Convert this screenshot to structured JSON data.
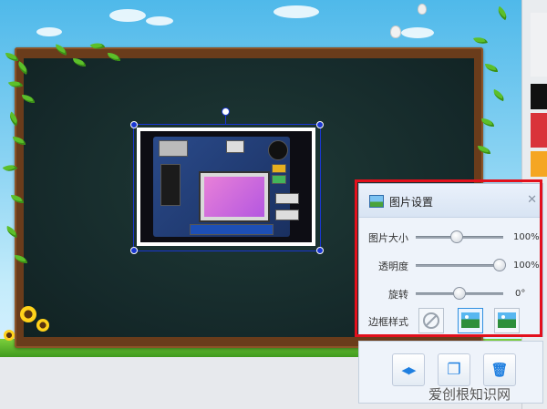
{
  "panel": {
    "title": "图片设置",
    "close_glyph": "✕",
    "size": {
      "label": "图片大小",
      "value": "100%",
      "level": 0.52
    },
    "opacity": {
      "label": "透明度",
      "value": "100%",
      "level": 1.0
    },
    "rotation": {
      "label": "旋转",
      "value": "0°",
      "level": 0.5
    },
    "frame": {
      "label": "边框样式",
      "options": [
        "none",
        "frame-style-1",
        "frame-style-2"
      ],
      "selected": 1
    }
  },
  "toolbar": {
    "buttons": [
      {
        "name": "flip-button",
        "icon": "flip-horizontal-icon",
        "glyph": "◀▶"
      },
      {
        "name": "copy-button",
        "icon": "copy-icon",
        "glyph": "❐"
      },
      {
        "name": "delete-button",
        "icon": "trash-icon",
        "glyph": "🗑"
      }
    ]
  },
  "watermark": "爱创根知识网",
  "colors": {
    "highlight": "#e3101c",
    "accent": "#1f7fe0",
    "selection": "#1a37d1"
  }
}
